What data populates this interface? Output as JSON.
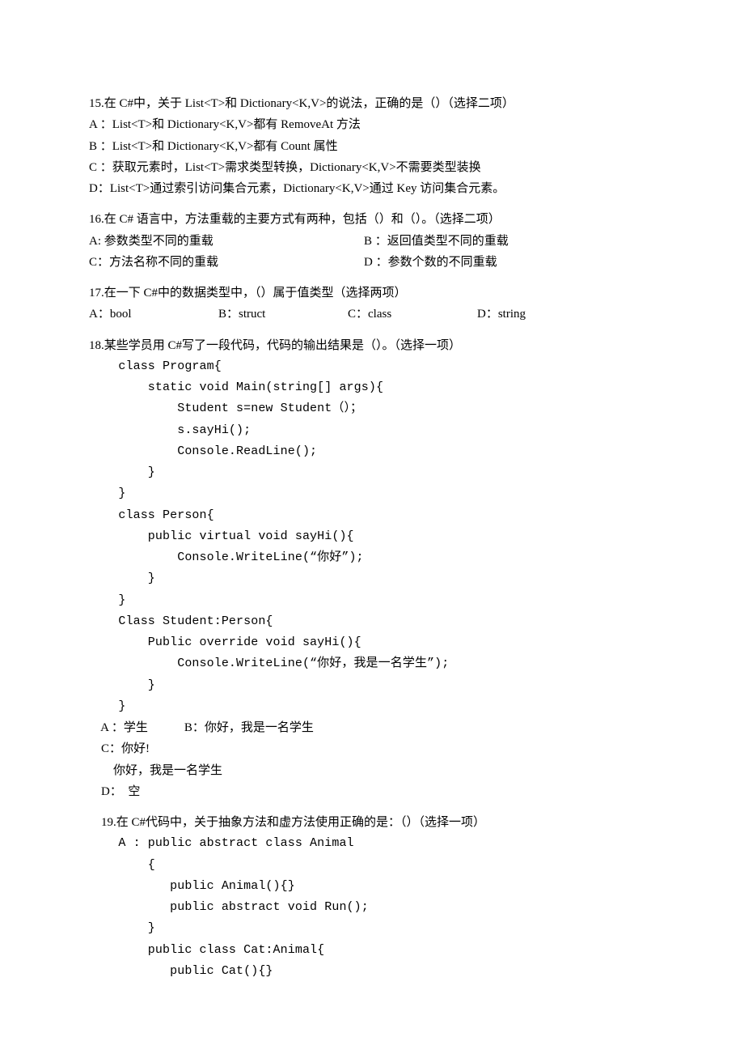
{
  "q15": {
    "stem": "15.在 C#中，关于 List<T>和 Dictionary<K,V>的说法，正确的是（）（选择二项）",
    "A": "A ：List<T>和 Dictionary<K,V>都有 RemoveAt 方法",
    "B": "B ：List<T>和 Dictionary<K,V>都有 Count 属性",
    "C": "C ：获取元素时，List<T>需求类型转换，Dictionary<K,V>不需要类型装换",
    "D": "D：List<T>通过索引访问集合元素，Dictionary<K,V>通过 Key 访问集合元素。"
  },
  "q16": {
    "stem": "16.在 C# 语言中，方法重载的主要方式有两种，包括（）和（）。（选择二项）",
    "A": "A: 参数类型不同的重载",
    "B": "B ：返回值类型不同的重载",
    "C": "C：方法名称不同的重载",
    "D": "D ：参数个数的不同重载"
  },
  "q17": {
    "stem": "17.在一下 C#中的数据类型中，（）属于值类型（选择两项）",
    "A": "A：bool",
    "B": "B：struct",
    "C": "C：class",
    "D": "D：string"
  },
  "q18": {
    "stem": "18.某些学员用 C#写了一段代码，代码的输出结果是（）。（选择一项）",
    "code": [
      "    class Program{",
      "        static void Main(string[] args){",
      "            Student s=new Student（）；",
      "            s.sayHi();",
      "            Console.ReadLine();",
      "        }",
      "    }",
      "    class Person{",
      "        public virtual void sayHi(){",
      "            Console.WriteLine(“你好”);",
      "        }",
      "    }",
      "    Class Student:Person{",
      "        Public override void sayHi(){",
      "            Console.WriteLine(“你好，我是一名学生”);",
      "        }",
      "    }"
    ],
    "optA": "    A ：学生            B：你好，我是一名学生",
    "optC": "    C：你好!",
    "optC2": "        你好，我是一名学生",
    "optD": "    D：  空"
  },
  "q19": {
    "stem": "    19.在 C#代码中，关于抽象方法和虚方法使用正确的是：（）（选择一项）",
    "code": [
      "    A : public abstract class Animal",
      "        {",
      "           public Animal(){}",
      "           public abstract void Run();",
      "        }",
      "        public class Cat:Animal{",
      "           public Cat(){}"
    ]
  }
}
